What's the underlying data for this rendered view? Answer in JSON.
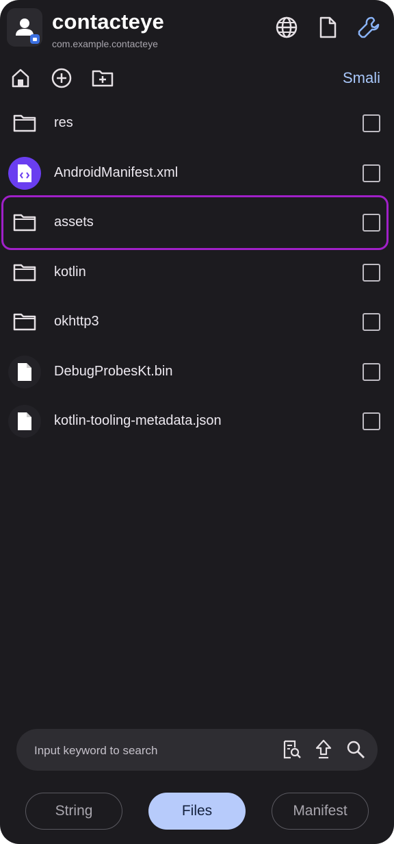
{
  "header": {
    "title": "contacteye",
    "package": "com.example.contacteye",
    "icons": [
      "globe-icon",
      "document-icon",
      "wrench-icon"
    ]
  },
  "toolbar": {
    "icons": [
      "home-icon",
      "add-circle-icon",
      "new-folder-icon"
    ],
    "smali_label": "Smali"
  },
  "files": [
    {
      "name": "res",
      "type": "folder",
      "icon": "folder-icon",
      "checked": false
    },
    {
      "name": "AndroidManifest.xml",
      "type": "manifest",
      "icon": "code-file-icon",
      "checked": false
    },
    {
      "name": "assets",
      "type": "folder",
      "icon": "folder-icon",
      "checked": false,
      "selected": true
    },
    {
      "name": "kotlin",
      "type": "folder",
      "icon": "folder-icon",
      "checked": false
    },
    {
      "name": "okhttp3",
      "type": "folder",
      "icon": "folder-icon",
      "checked": false
    },
    {
      "name": "DebugProbesKt.bin",
      "type": "file",
      "icon": "file-icon",
      "checked": false
    },
    {
      "name": "kotlin-tooling-metadata.json",
      "type": "file",
      "icon": "file-icon",
      "checked": false
    }
  ],
  "search": {
    "placeholder": "Input keyword to search",
    "value": "",
    "icons": [
      "find-in-page-icon",
      "upload-arrow-icon",
      "search-icon"
    ]
  },
  "tabs": [
    {
      "label": "String",
      "active": false
    },
    {
      "label": "Files",
      "active": true
    },
    {
      "label": "Manifest",
      "active": false
    }
  ],
  "colors": {
    "background": "#1c1b1f",
    "accent_link": "#a8c7fa",
    "active_tab": "#b7cbfb",
    "selection_border": "#a020c8",
    "manifest_icon_bg": "#6a3ef0"
  }
}
